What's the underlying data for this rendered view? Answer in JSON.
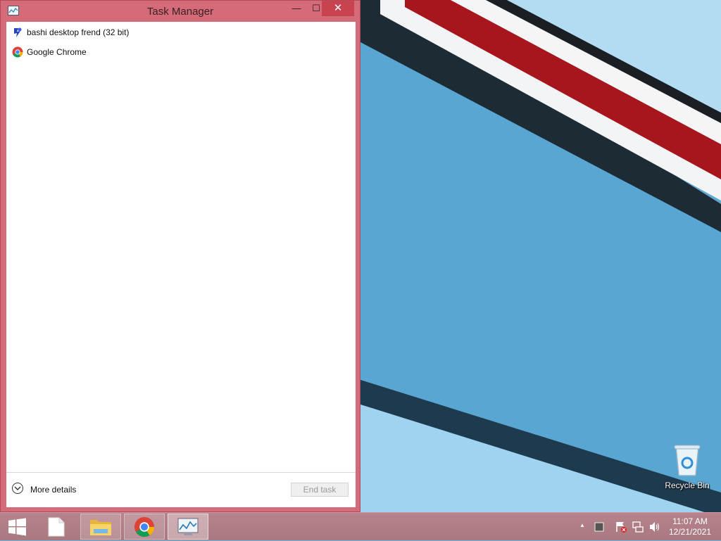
{
  "window": {
    "title": "Task Manager",
    "buttons": {
      "minimize": "—",
      "maximize": "☐",
      "close": "✕"
    }
  },
  "processes": [
    {
      "name": "bashi desktop frend (32 bit)",
      "icon": "bashi-app-icon"
    },
    {
      "name": "Google Chrome",
      "icon": "chrome-icon"
    }
  ],
  "footer": {
    "more_details_label": "More details",
    "end_task_label": "End task",
    "end_task_enabled": false
  },
  "desktop": {
    "recycle_bin_label": "Recycle Bin"
  },
  "taskbar": {
    "items": [
      {
        "icon": "windows-start-icon"
      },
      {
        "icon": "blank-document-icon"
      },
      {
        "icon": "file-explorer-icon"
      },
      {
        "icon": "chrome-icon"
      },
      {
        "icon": "task-manager-icon"
      }
    ],
    "tray": {
      "show_hidden_label": "▲",
      "time": "11:07 AM",
      "date": "12/21/2021"
    }
  },
  "colors": {
    "window_frame": "#d56b78",
    "close_button": "#c9424f",
    "taskbar": "#b6848a"
  }
}
